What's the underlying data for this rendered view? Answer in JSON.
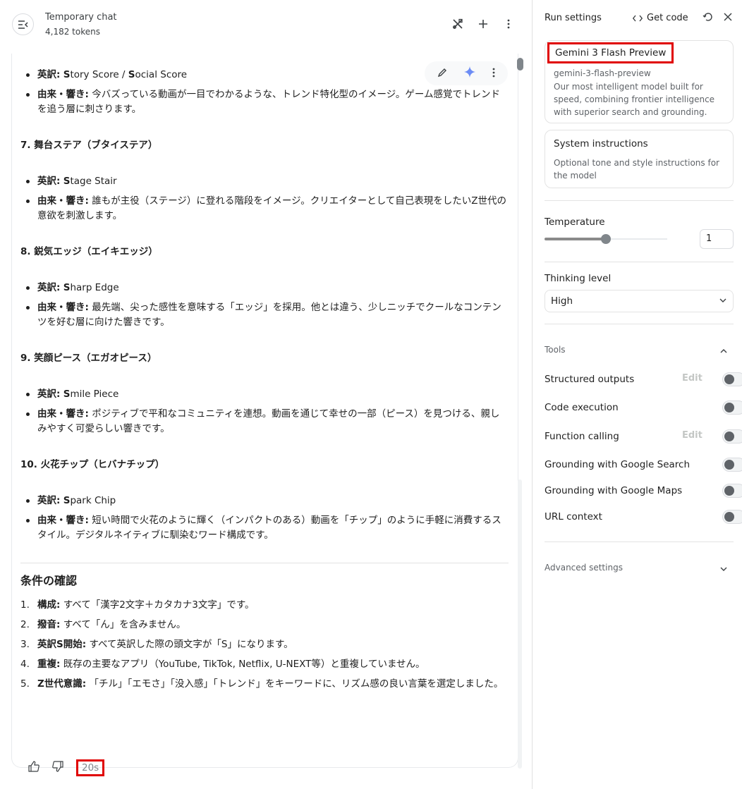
{
  "header": {
    "title": "Temporary chat",
    "tokens": "4,182 tokens"
  },
  "message": {
    "item6": {
      "en_label": "英訳:",
      "en_value_S1": "S",
      "en_value_rest1": "tory Score / ",
      "en_value_S2": "S",
      "en_value_rest2": "ocial Score",
      "origin_label": "由来・響き:",
      "origin_text": "今バズっている動画が一目でわかるような、トレンド特化型のイメージ。ゲーム感覚でトレンドを追う層に刺さります。"
    },
    "item7": {
      "heading": "7. 舞台ステア（ブタイステア）",
      "en_label": "英訳:",
      "en_S": "S",
      "en_rest": "tage Stair",
      "origin_label": "由来・響き:",
      "origin_text": "誰もが主役（ステージ）に登れる階段をイメージ。クリエイターとして自己表現をしたいZ世代の意欲を刺激します。"
    },
    "item8": {
      "heading": "8. 鋭気エッジ（エイキエッジ）",
      "en_label": "英訳:",
      "en_S": "S",
      "en_rest": "harp Edge",
      "origin_label": "由来・響き:",
      "origin_text": "最先端、尖った感性を意味する「エッジ」を採用。他とは違う、少しニッチでクールなコンテンツを好む層に向けた響きです。"
    },
    "item9": {
      "heading": "9. 笑顔ピース（エガオピース）",
      "en_label": "英訳:",
      "en_S": "S",
      "en_rest": "mile Piece",
      "origin_label": "由来・響き:",
      "origin_text": "ポジティブで平和なコミュニティを連想。動画を通じて幸せの一部（ピース）を見つける、親しみやすく可愛らしい響きです。"
    },
    "item10": {
      "heading": "10. 火花チップ（ヒバナチップ）",
      "en_label": "英訳:",
      "en_S": "S",
      "en_rest": "park Chip",
      "origin_label": "由来・響き:",
      "origin_text": "短い時間で火花のように輝く（インパクトのある）動画を「チップ」のように手軽に消費するスタイル。デジタルネイティブに馴染むワード構成です。"
    },
    "conditions": {
      "title": "条件の確認",
      "items": [
        {
          "num": "1.",
          "label": "構成:",
          "text": "すべて「漢字2文字＋カタカナ3文字」です。"
        },
        {
          "num": "2.",
          "label": "撥音:",
          "text": "すべて「ん」を含みません。"
        },
        {
          "num": "3.",
          "label": "英訳S開始:",
          "text": "すべて英訳した際の頭文字が「S」になります。"
        },
        {
          "num": "4.",
          "label": "重複:",
          "text": "既存の主要なアプリ（YouTube, TikTok, Netflix, U-NEXT等）と重複していません。"
        },
        {
          "num": "5.",
          "label": "Z世代意識:",
          "text": "「チル」「エモさ」「没入感」「トレンド」をキーワードに、リズム感の良い言葉を選定しました。"
        }
      ]
    },
    "elapsed": "20s"
  },
  "panel": {
    "title": "Run settings",
    "get_code": "Get code",
    "model": {
      "name": "Gemini 3 Flash Preview",
      "id": "gemini-3-flash-preview",
      "description": "Our most intelligent model built for speed, combining frontier intelligence with superior search and grounding."
    },
    "system": {
      "title": "System instructions",
      "description": "Optional tone and style instructions for the model"
    },
    "temperature": {
      "label": "Temperature",
      "value": "1",
      "fraction": 0.5
    },
    "thinking": {
      "label": "Thinking level",
      "value": "High"
    },
    "tools": {
      "label": "Tools",
      "items": [
        {
          "name": "Structured outputs",
          "edit": "Edit",
          "enabled": false
        },
        {
          "name": "Code execution",
          "edit": "",
          "enabled": false
        },
        {
          "name": "Function calling",
          "edit": "Edit",
          "enabled": false
        },
        {
          "name": "Grounding with Google Search",
          "edit": "",
          "enabled": false
        },
        {
          "name": "Grounding with Google Maps",
          "edit": "",
          "enabled": false
        },
        {
          "name": "URL context",
          "edit": "",
          "enabled": false
        }
      ]
    },
    "advanced": "Advanced settings"
  }
}
